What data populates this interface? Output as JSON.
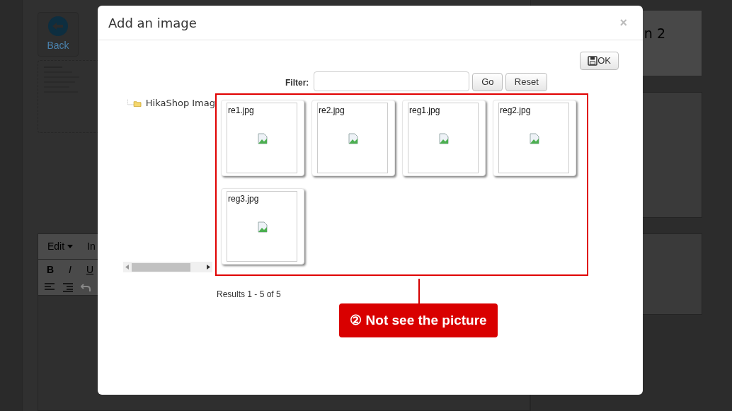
{
  "background": {
    "back_button": "Back",
    "menu": [
      "Edit",
      "In"
    ],
    "format_buttons": [
      "B",
      "I",
      "U"
    ],
    "panel_title": "n 2"
  },
  "dialog": {
    "title": "Add an image",
    "close": "×",
    "ok_button": "OK",
    "filter_label": "Filter:",
    "go_button": "Go",
    "reset_button": "Reset",
    "tree": [
      {
        "label": "HikaShop Imag"
      }
    ],
    "images": [
      {
        "name": "re1.jpg"
      },
      {
        "name": "re2.jpg"
      },
      {
        "name": "reg1.jpg"
      },
      {
        "name": "reg2.jpg"
      },
      {
        "name": "reg3.jpg"
      }
    ],
    "results": "Results 1 - 5 of 5"
  },
  "annotation": {
    "text": "② Not see the picture"
  }
}
